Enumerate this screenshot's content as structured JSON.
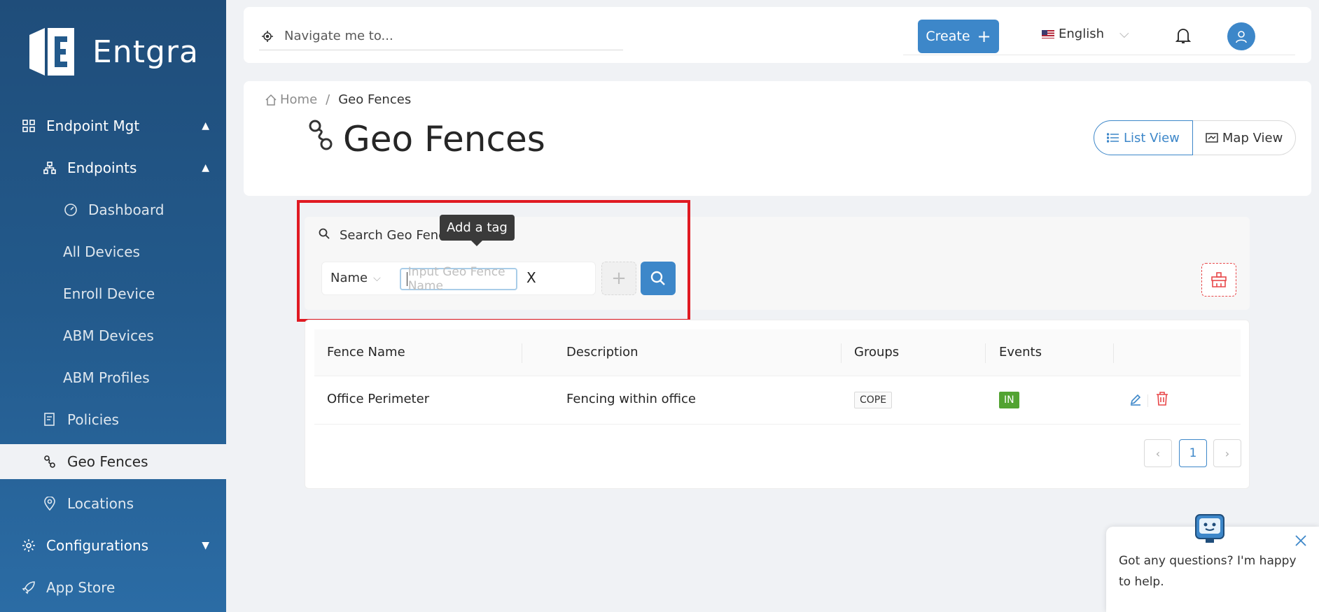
{
  "sidebar": {
    "brand": "Entgra",
    "items": [
      {
        "label": "Endpoint Mgt"
      },
      {
        "label": "Endpoints"
      },
      {
        "label": "Dashboard"
      },
      {
        "label": "All Devices"
      },
      {
        "label": "Enroll Device"
      },
      {
        "label": "ABM Devices"
      },
      {
        "label": "ABM Profiles"
      },
      {
        "label": "Policies"
      },
      {
        "label": "Geo Fences"
      },
      {
        "label": "Locations"
      },
      {
        "label": "Configurations"
      },
      {
        "label": "App Store"
      }
    ]
  },
  "header": {
    "nav_placeholder": "Navigate me to...",
    "create_label": "Create",
    "language": "English"
  },
  "page": {
    "breadcrumb_home": "Home",
    "breadcrumb_sep": "/",
    "breadcrumb_current": "Geo Fences",
    "title": "Geo Fences",
    "list_view": "List View",
    "map_view": "Map View"
  },
  "search": {
    "label": "Search Geo Fence",
    "field": "Name",
    "placeholder": "Input Geo Fence Name",
    "clear": "X",
    "tooltip": "Add a tag"
  },
  "table": {
    "columns": [
      "Fence Name",
      "Description",
      "Groups",
      "Events"
    ],
    "rows": [
      {
        "name": "Office Perimeter",
        "description": "Fencing within office",
        "group": "COPE",
        "event": "IN"
      }
    ],
    "page": "1"
  },
  "chat": {
    "message": "Got any questions? I'm happy to help."
  },
  "colors": {
    "primary": "#3d87c9",
    "sidebar": "#235a8c",
    "danger": "#e84749",
    "success": "#52a332",
    "highlight": "#e01a22"
  }
}
